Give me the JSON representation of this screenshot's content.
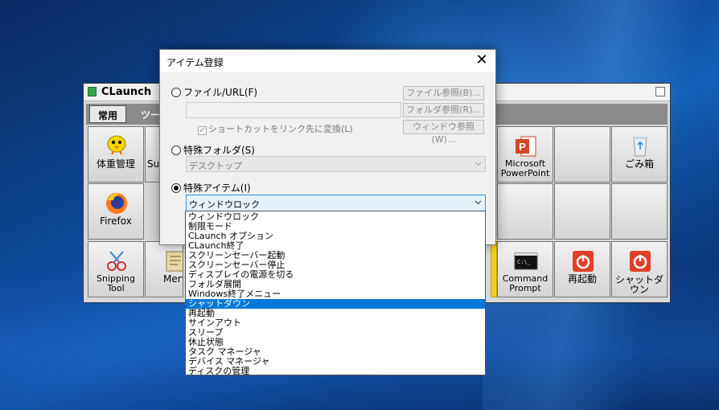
{
  "claunch": {
    "title": "CLaunch",
    "tabs": [
      {
        "label": "常用",
        "active": true
      },
      {
        "label": "ツー",
        "active": false
      }
    ],
    "items": [
      {
        "label": "体重管理",
        "icon": "bird-icon"
      },
      {
        "label": "Sup",
        "icon": "app-icon"
      },
      {
        "label": "Microsoft PowerPoint",
        "icon": "powerpoint-icon"
      },
      {
        "label": "ごみ箱",
        "icon": "recycle-bin-icon"
      },
      {
        "label": "Firefox",
        "icon": "firefox-icon"
      },
      {
        "label": "Snipping Tool",
        "icon": "scissors-icon"
      },
      {
        "label": "Mery",
        "icon": "notepad-icon"
      },
      {
        "label": "Command Prompt",
        "icon": "terminal-icon"
      },
      {
        "label": "再起動",
        "icon": "power-icon"
      },
      {
        "label": "シャットダウン",
        "icon": "power-icon"
      }
    ]
  },
  "dialog": {
    "title": "アイテム登録",
    "close": "✕",
    "radio_file": "ファイル/URL(F)",
    "file_input_value": "",
    "btn_file_browse": "ファイル参照(B)...",
    "btn_folder_browse": "フォルダ参照(R)...",
    "btn_window_browse": "ウィンドウ参照(W)...",
    "checkbox_shortcut": "ショートカットをリンク先に変換(L)",
    "radio_special_folder": "特殊フォルダ(S)",
    "special_folder_value": "デスクトップ",
    "radio_special_item": "特殊アイテム(I)",
    "special_item_value": "ウィンドウロック",
    "special_item_options": [
      "ウィンドウロック",
      "制限モード",
      "CLaunch オプション",
      "CLaunch終了",
      "スクリーンセーバー起動",
      "スクリーンセーバー停止",
      "ディスプレイの電源を切る",
      "フォルダ展開",
      "Windows終了メニュー",
      "シャットダウン",
      "再起動",
      "サインアウト",
      "スリープ",
      "休止状態",
      "タスク マネージャ",
      "デバイス マネージャ",
      "ディスクの管理"
    ],
    "highlighted_index": 9
  },
  "colors": {
    "selection": "#0078d7",
    "desktop": "#0d4a9a",
    "power_red": "#e0402a"
  }
}
